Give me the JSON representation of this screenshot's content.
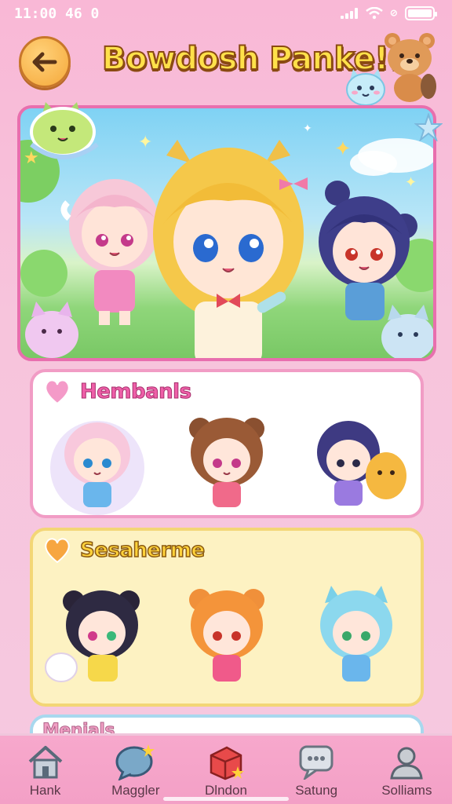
{
  "status_bar": {
    "time": "11:00 46 0"
  },
  "header": {
    "title": "Bowdosh Panke!!"
  },
  "sections": [
    {
      "title": "Hembanls"
    },
    {
      "title": "Sesaherme"
    },
    {
      "title": "Menials"
    }
  ],
  "nav": [
    {
      "label": "Hank",
      "icon": "home-icon"
    },
    {
      "label": "Maggler",
      "icon": "chat-bubble-icon"
    },
    {
      "label": "Dlndon",
      "icon": "gift-box-icon"
    },
    {
      "label": "Satung",
      "icon": "message-icon"
    },
    {
      "label": "Solliams",
      "icon": "profile-icon"
    }
  ],
  "colors": {
    "accent": "#e86fae",
    "title": "#ffe14a",
    "nav_bg": "#f7a8cc"
  }
}
